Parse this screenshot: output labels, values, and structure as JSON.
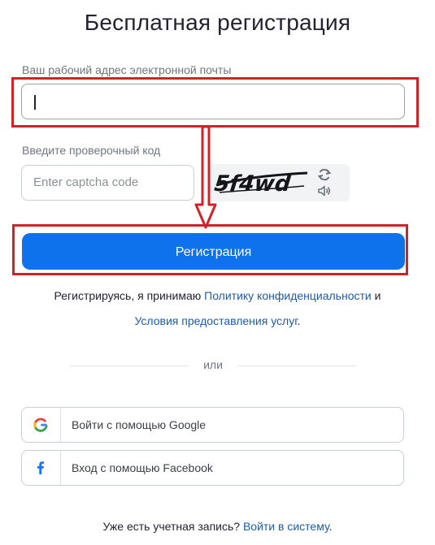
{
  "page_title": "Бесплатная регистрация",
  "email": {
    "label": "Ваш рабочий адрес электронной почты",
    "value": ""
  },
  "captcha": {
    "label": "Введите проверочный код",
    "placeholder": "Enter captcha code",
    "image_text": "5f4wd"
  },
  "register_button": "Регистрация",
  "terms": {
    "prefix": "Регистрируясь, я принимаю ",
    "privacy_link": "Политику конфиденциальности",
    "conjunction": " и",
    "terms_link": "Условия предоставления услуг",
    "suffix": "."
  },
  "divider_text": "или",
  "social": {
    "google_label": "Войти с помощью Google",
    "facebook_label": "Вход с помощью Facebook"
  },
  "signin": {
    "prefix": "Уже есть учетная запись? ",
    "link": "Войти в систему",
    "suffix": "."
  },
  "colors": {
    "primary_button": "#0e72ed",
    "link": "#1c5ca8",
    "highlight_annotation": "#d1222a"
  }
}
